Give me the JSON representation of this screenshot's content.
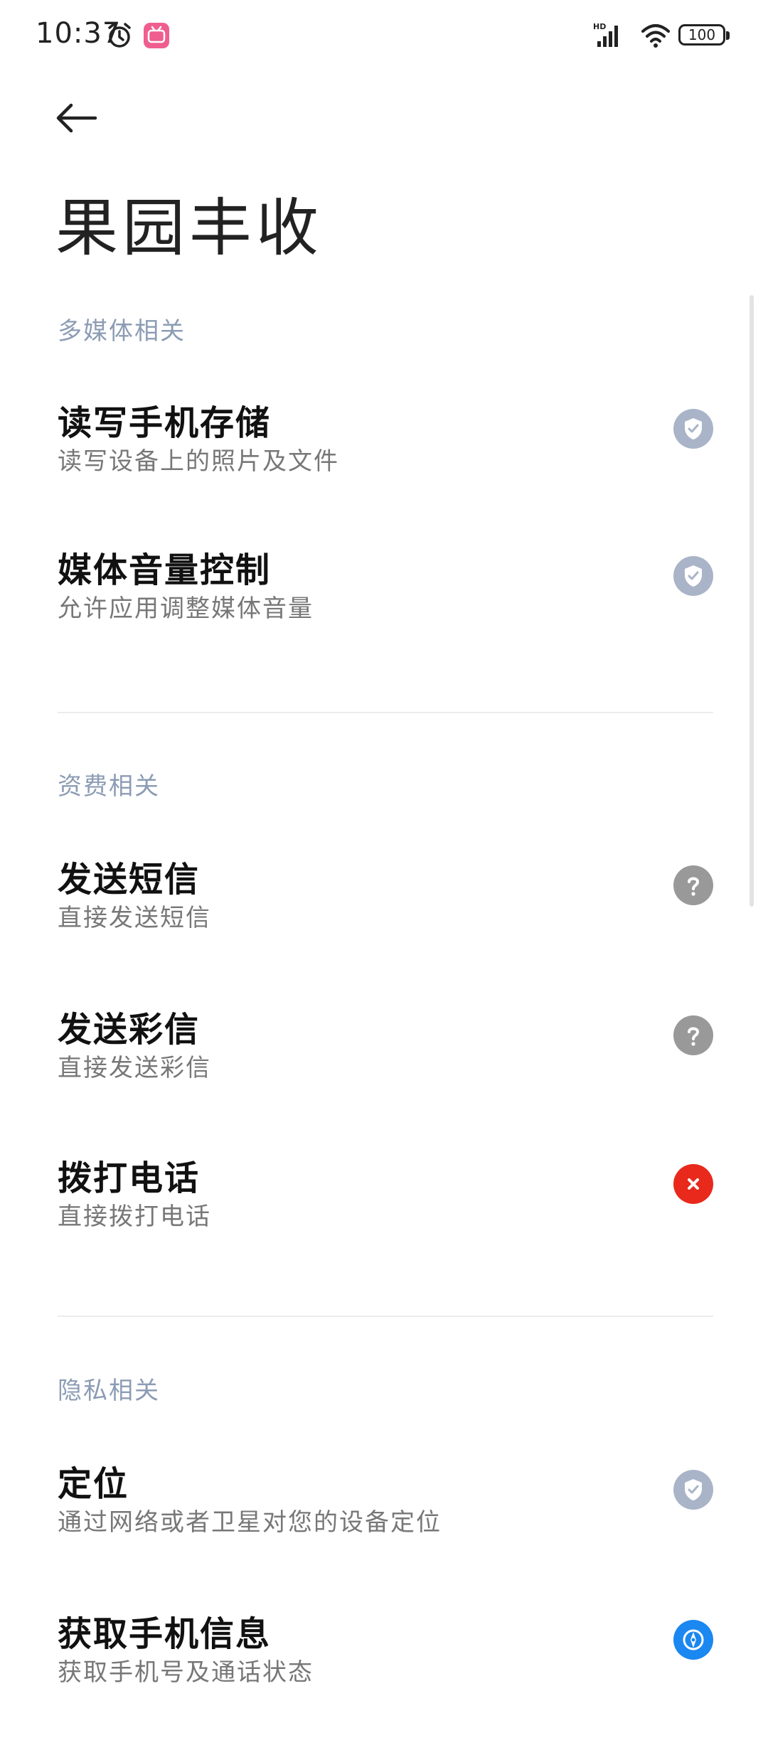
{
  "status_bar": {
    "time": "10:37",
    "battery": "100",
    "icons": [
      "alarm-icon",
      "bilibili-app-icon",
      "hd-signal-icon",
      "wifi-icon",
      "battery-icon"
    ]
  },
  "header": {
    "back_icon": "back-arrow-icon",
    "title": "果园丰收"
  },
  "colors": {
    "section_header": "#8c9cb4",
    "status_allowed": "#a9b4c8",
    "status_ask": "#999999",
    "status_denied": "#e8291b",
    "status_info": "#1b87f0"
  },
  "sections": [
    {
      "header": "多媒体相关",
      "items": [
        {
          "title": "读写手机存储",
          "desc": "读写设备上的照片及文件",
          "status": "allowed"
        },
        {
          "title": "媒体音量控制",
          "desc": "允许应用调整媒体音量",
          "status": "allowed"
        }
      ]
    },
    {
      "header": "资费相关",
      "items": [
        {
          "title": "发送短信",
          "desc": "直接发送短信",
          "status": "ask"
        },
        {
          "title": "发送彩信",
          "desc": "直接发送彩信",
          "status": "ask"
        },
        {
          "title": "拨打电话",
          "desc": "直接拨打电话",
          "status": "denied"
        }
      ]
    },
    {
      "header": "隐私相关",
      "items": [
        {
          "title": "定位",
          "desc": "通过网络或者卫星对您的设备定位",
          "status": "allowed"
        },
        {
          "title": "获取手机信息",
          "desc": "获取手机号及通话状态",
          "status": "info"
        }
      ]
    }
  ]
}
